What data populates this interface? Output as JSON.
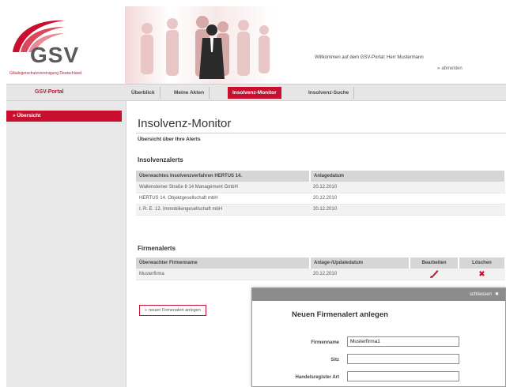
{
  "header": {
    "logo_text": "GSV",
    "logo_subtitle": "Gläubigerschutzvereinigung Deutschland",
    "welcome_text": "Willkommen auf dem GSV-Portal: Herr Mustermann",
    "logout_label": "abmelden"
  },
  "nav": {
    "portal_label": "GSV-Portal",
    "tabs": [
      {
        "label": "Überblick"
      },
      {
        "label": "Meine Akten"
      },
      {
        "label": "Insolvenz-Monitor"
      },
      {
        "label": "Insolvenz-Suche"
      }
    ]
  },
  "sidebar": {
    "items": [
      {
        "label": "Übersicht"
      }
    ]
  },
  "main": {
    "title": "Insolvenz-Monitor",
    "subtitle": "Übersicht über Ihre Alerts",
    "insolvency_alerts": {
      "heading": "Insolvenzalerts",
      "columns": [
        "Überwachtes Insolvenzverfahren HERTUS 14.",
        "Anlagedatum"
      ],
      "rows": [
        [
          "Wallensteiner Straße 8 14 Management GmbH",
          "20.12.2010"
        ],
        [
          "HERTUS 14. Objektgesellschaft mbH",
          "20.12.2010"
        ],
        [
          "I. R. E. 12. Immobiliengesellschaft mbH",
          "20.12.2010"
        ]
      ]
    },
    "company_alerts": {
      "heading": "Firmenalerts",
      "columns": [
        "Überwachter Firmenname",
        "Anlage-/Updatedatum",
        "Bearbeiten",
        "Löschen"
      ],
      "rows": [
        [
          "Musterfirma",
          "20.12.2010"
        ]
      ]
    },
    "new_alert_button": "neuen Firmenalert anlegen"
  },
  "modal": {
    "close_label": "schliessen",
    "title": "Neuen Firmenalert anlegen",
    "fields": [
      {
        "label": "Firmenname",
        "value": "Musterfirma1"
      },
      {
        "label": "Sitz",
        "value": ""
      },
      {
        "label": "Handelsregister Art",
        "value": ""
      }
    ]
  },
  "colors": {
    "accent": "#c8102e",
    "nav_bg": "#e6e6e6",
    "sidebar_bg": "#e8e8e8",
    "modal_bar": "#8c8c8c"
  },
  "icons": [
    "edit-icon",
    "delete-icon",
    "close-icon"
  ]
}
